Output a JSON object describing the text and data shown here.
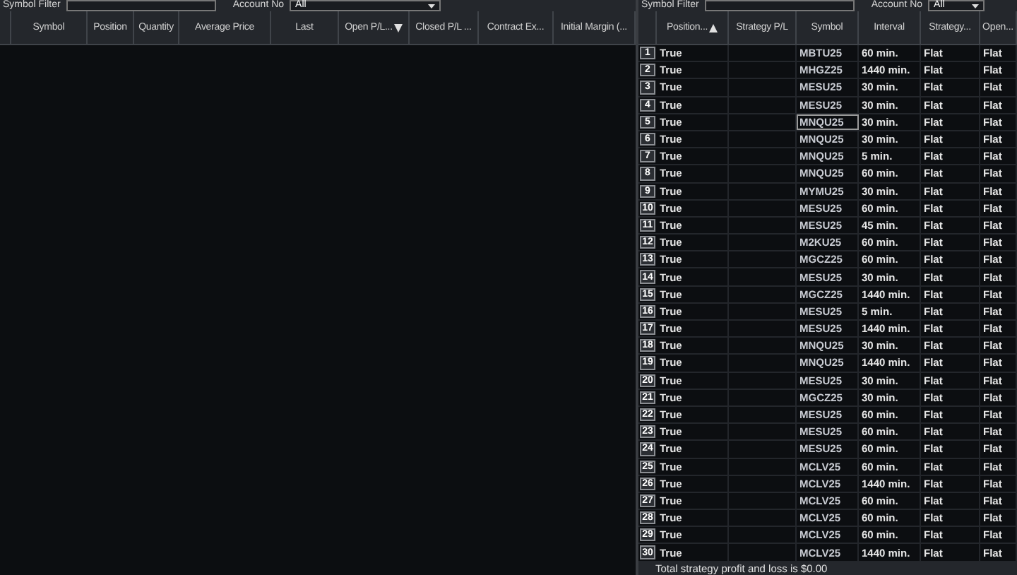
{
  "left_panel": {
    "filters": {
      "symbol_filter_label": "Symbol Filter",
      "account_label": "Account No",
      "account_value": "All"
    },
    "columns": [
      {
        "sorted": false
      },
      {
        "label": "Symbol",
        "sorted": false
      },
      {
        "label": "Position",
        "sorted": false
      },
      {
        "label": "Quantity",
        "sorted": false
      },
      {
        "label": "Average Price",
        "sorted": false
      },
      {
        "label": "Last",
        "sorted": false
      },
      {
        "label": "Open P/L...",
        "sorted": true,
        "ascending": false
      },
      {
        "label": "Closed P/L ...",
        "sorted": false
      },
      {
        "label": "Contract Ex...",
        "sorted": false
      },
      {
        "label": "Initial Margin (...",
        "sorted": false
      }
    ]
  },
  "right_panel": {
    "filters": {
      "symbol_filter_label": "Symbol Filter",
      "account_label": "Account No",
      "account_value": "All"
    },
    "columns": [
      {
        "sorted": false
      },
      {
        "label": "Position...",
        "sorted": true,
        "ascending": true
      },
      {
        "label": "Strategy P/L",
        "sorted": false
      },
      {
        "label": "Symbol",
        "sorted": false
      },
      {
        "label": "Interval",
        "sorted": false
      },
      {
        "label": "Strategy...",
        "sorted": false
      },
      {
        "label": "Open...",
        "sorted": false
      }
    ],
    "rows": [
      {
        "n": "1",
        "position": "True",
        "pl": "",
        "symbol": "MBTU25",
        "interval": "60 min.",
        "strategy": "Flat",
        "open": "Flat",
        "focused": false
      },
      {
        "n": "2",
        "position": "True",
        "pl": "",
        "symbol": "MHGZ25",
        "interval": "1440 min.",
        "strategy": "Flat",
        "open": "Flat",
        "focused": false
      },
      {
        "n": "3",
        "position": "True",
        "pl": "",
        "symbol": "MESU25",
        "interval": "30 min.",
        "strategy": "Flat",
        "open": "Flat",
        "focused": false
      },
      {
        "n": "4",
        "position": "True",
        "pl": "",
        "symbol": "MESU25",
        "interval": "30 min.",
        "strategy": "Flat",
        "open": "Flat",
        "focused": false
      },
      {
        "n": "5",
        "position": "True",
        "pl": "",
        "symbol": "MNQU25",
        "interval": "30 min.",
        "strategy": "Flat",
        "open": "Flat",
        "focused": true
      },
      {
        "n": "6",
        "position": "True",
        "pl": "",
        "symbol": "MNQU25",
        "interval": "30 min.",
        "strategy": "Flat",
        "open": "Flat",
        "focused": false
      },
      {
        "n": "7",
        "position": "True",
        "pl": "",
        "symbol": "MNQU25",
        "interval": "5 min.",
        "strategy": "Flat",
        "open": "Flat",
        "focused": false
      },
      {
        "n": "8",
        "position": "True",
        "pl": "",
        "symbol": "MNQU25",
        "interval": "60 min.",
        "strategy": "Flat",
        "open": "Flat",
        "focused": false
      },
      {
        "n": "9",
        "position": "True",
        "pl": "",
        "symbol": "MYMU25",
        "interval": "30 min.",
        "strategy": "Flat",
        "open": "Flat",
        "focused": false
      },
      {
        "n": "10",
        "position": "True",
        "pl": "",
        "symbol": "MESU25",
        "interval": "60 min.",
        "strategy": "Flat",
        "open": "Flat",
        "focused": false
      },
      {
        "n": "11",
        "position": "True",
        "pl": "",
        "symbol": "MESU25",
        "interval": "45 min.",
        "strategy": "Flat",
        "open": "Flat",
        "focused": false
      },
      {
        "n": "12",
        "position": "True",
        "pl": "",
        "symbol": "M2KU25",
        "interval": "60 min.",
        "strategy": "Flat",
        "open": "Flat",
        "focused": false
      },
      {
        "n": "13",
        "position": "True",
        "pl": "",
        "symbol": "MGCZ25",
        "interval": "60 min.",
        "strategy": "Flat",
        "open": "Flat",
        "focused": false
      },
      {
        "n": "14",
        "position": "True",
        "pl": "",
        "symbol": "MESU25",
        "interval": "30 min.",
        "strategy": "Flat",
        "open": "Flat",
        "focused": false
      },
      {
        "n": "15",
        "position": "True",
        "pl": "",
        "symbol": "MGCZ25",
        "interval": "1440 min.",
        "strategy": "Flat",
        "open": "Flat",
        "focused": false
      },
      {
        "n": "16",
        "position": "True",
        "pl": "",
        "symbol": "MESU25",
        "interval": "5 min.",
        "strategy": "Flat",
        "open": "Flat",
        "focused": false
      },
      {
        "n": "17",
        "position": "True",
        "pl": "",
        "symbol": "MESU25",
        "interval": "1440 min.",
        "strategy": "Flat",
        "open": "Flat",
        "focused": false
      },
      {
        "n": "18",
        "position": "True",
        "pl": "",
        "symbol": "MNQU25",
        "interval": "30 min.",
        "strategy": "Flat",
        "open": "Flat",
        "focused": false
      },
      {
        "n": "19",
        "position": "True",
        "pl": "",
        "symbol": "MNQU25",
        "interval": "1440 min.",
        "strategy": "Flat",
        "open": "Flat",
        "focused": false
      },
      {
        "n": "20",
        "position": "True",
        "pl": "",
        "symbol": "MESU25",
        "interval": "30 min.",
        "strategy": "Flat",
        "open": "Flat",
        "focused": false
      },
      {
        "n": "21",
        "position": "True",
        "pl": "",
        "symbol": "MGCZ25",
        "interval": "30 min.",
        "strategy": "Flat",
        "open": "Flat",
        "focused": false
      },
      {
        "n": "22",
        "position": "True",
        "pl": "",
        "symbol": "MESU25",
        "interval": "60 min.",
        "strategy": "Flat",
        "open": "Flat",
        "focused": false
      },
      {
        "n": "23",
        "position": "True",
        "pl": "",
        "symbol": "MESU25",
        "interval": "60 min.",
        "strategy": "Flat",
        "open": "Flat",
        "focused": false
      },
      {
        "n": "24",
        "position": "True",
        "pl": "",
        "symbol": "MESU25",
        "interval": "60 min.",
        "strategy": "Flat",
        "open": "Flat",
        "focused": false
      },
      {
        "n": "25",
        "position": "True",
        "pl": "",
        "symbol": "MCLV25",
        "interval": "60 min.",
        "strategy": "Flat",
        "open": "Flat",
        "focused": false
      },
      {
        "n": "26",
        "position": "True",
        "pl": "",
        "symbol": "MCLV25",
        "interval": "1440 min.",
        "strategy": "Flat",
        "open": "Flat",
        "focused": false
      },
      {
        "n": "27",
        "position": "True",
        "pl": "",
        "symbol": "MCLV25",
        "interval": "60 min.",
        "strategy": "Flat",
        "open": "Flat",
        "focused": false
      },
      {
        "n": "28",
        "position": "True",
        "pl": "",
        "symbol": "MCLV25",
        "interval": "60 min.",
        "strategy": "Flat",
        "open": "Flat",
        "focused": false
      },
      {
        "n": "29",
        "position": "True",
        "pl": "",
        "symbol": "MCLV25",
        "interval": "60 min.",
        "strategy": "Flat",
        "open": "Flat",
        "focused": false
      },
      {
        "n": "30",
        "position": "True",
        "pl": "",
        "symbol": "MCLV25",
        "interval": "1440 min.",
        "strategy": "Flat",
        "open": "Flat",
        "focused": false
      }
    ],
    "footer": "Total strategy profit and loss is $0.00"
  }
}
